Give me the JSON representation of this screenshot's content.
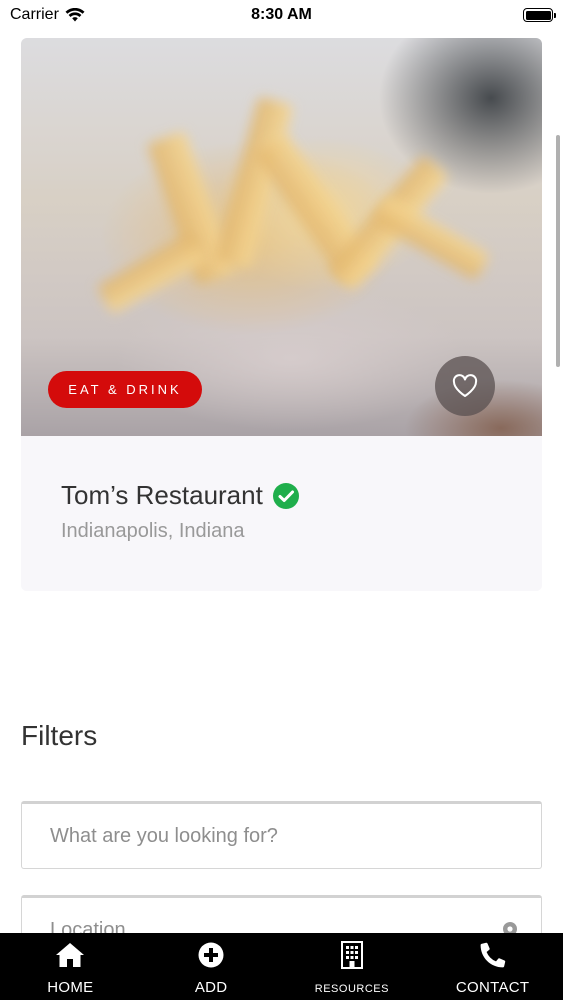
{
  "status_bar": {
    "carrier": "Carrier",
    "time": "8:30 AM"
  },
  "listing": {
    "category": "EAT & DRINK",
    "title": "Tom’s Restaurant",
    "location": "Indianapolis, Indiana",
    "verified_color": "#1fae4b",
    "badge_color": "#cc0d0d"
  },
  "filters": {
    "heading": "Filters",
    "search_placeholder": "What are you looking for?",
    "location_placeholder": "Location"
  },
  "tabs": [
    {
      "label": "HOME",
      "icon": "home-icon"
    },
    {
      "label": "ADD",
      "icon": "plus-circle-icon"
    },
    {
      "label": "RESOURCES",
      "icon": "building-icon"
    },
    {
      "label": "CONTACT",
      "icon": "phone-icon"
    }
  ]
}
